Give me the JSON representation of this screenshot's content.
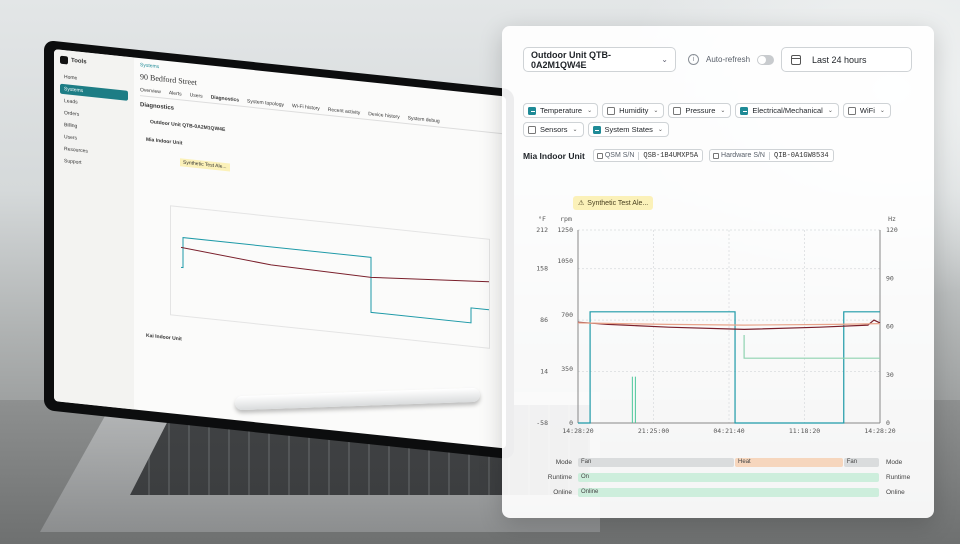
{
  "laptop": {
    "brand": "Tools",
    "nav": [
      "Home",
      "Systems",
      "Leads",
      "Orders",
      "Billing",
      "Users",
      "Resources",
      "Support"
    ],
    "breadcrumb": "Systems",
    "address": "90 Bedford Street",
    "tabs": [
      "Overview",
      "Alerts",
      "Users",
      "Diagnostics",
      "System topology",
      "Wi-Fi history",
      "Recent activity",
      "Device history",
      "System debug"
    ],
    "section": "Diagnostics",
    "unit": "Outdoor Unit QTB-0A2M1QW4E",
    "indoor_a": "Mia Indoor Unit",
    "indoor_b": "Kai Indoor Unit",
    "alert": "Synthetic Test Ale..."
  },
  "panel": {
    "unit_select": "Outdoor Unit QTB-0A2M1QW4E",
    "auto_refresh": "Auto-refresh",
    "time_range": "Last 24 hours",
    "filters": [
      {
        "label": "Temperature",
        "checked": true
      },
      {
        "label": "Humidity",
        "checked": false
      },
      {
        "label": "Pressure",
        "checked": false
      },
      {
        "label": "Electrical/Mechanical",
        "checked": true
      },
      {
        "label": "WiFi",
        "checked": false
      },
      {
        "label": "Sensors",
        "checked": false
      },
      {
        "label": "System States",
        "checked": true
      }
    ],
    "indoor_name": "Mia Indoor Unit",
    "qsm_label": "QSM S/N",
    "qsm_value": "QSB-1B4UMXP5A",
    "hw_label": "Hardware S/N",
    "hw_value": "QIB-0A1GW8534",
    "alert": "Synthetic Test Ale..."
  },
  "chart_data": {
    "type": "line",
    "axis_units": {
      "left_outer": "°F",
      "left_inner": "rpm",
      "right": "Hz"
    },
    "y_left_temp": {
      "ticks": [
        -58,
        14,
        86,
        158,
        212
      ],
      "range": [
        -58,
        212
      ]
    },
    "y_left_rpm": {
      "ticks": [
        0,
        350,
        700,
        1050,
        1250
      ],
      "range": [
        0,
        1250
      ]
    },
    "y_right_hz": {
      "ticks": [
        0,
        30,
        60,
        90,
        120
      ],
      "range": [
        0,
        120
      ]
    },
    "x_ticks": [
      "14:28:20",
      "21:25:00",
      "04:21:40",
      "11:18:20",
      "14:28:20"
    ],
    "series": [
      {
        "color": "#1e9aa8",
        "x": [
          0,
          0.04,
          0.04,
          0.52,
          0.52,
          0.88,
          0.88,
          1.0
        ],
        "y_rpm": [
          0,
          0,
          720,
          720,
          0,
          0,
          720,
          720
        ]
      },
      {
        "color": "#7a1f2b",
        "x": [
          0,
          0.1,
          0.3,
          0.55,
          0.8,
          0.96,
          0.98,
          1.0
        ],
        "y_temp": [
          83,
          80,
          76,
          73,
          76,
          79,
          86,
          82
        ]
      },
      {
        "color": "#e8a48a",
        "x": [
          0,
          0.3,
          0.55,
          0.85,
          1.0
        ],
        "y_temp": [
          82,
          80,
          79,
          80,
          81
        ]
      },
      {
        "color": "#8fd3b0",
        "x": [
          0.55,
          0.55,
          1.0
        ],
        "y_rpm": [
          570,
          420,
          420
        ]
      }
    ],
    "states": {
      "Mode": [
        {
          "label": "Fan",
          "from": 0.0,
          "to": 0.52,
          "color": "#dadcdd"
        },
        {
          "label": "Heat",
          "from": 0.52,
          "to": 0.88,
          "color": "#f6d6bd"
        },
        {
          "label": "Fan",
          "from": 0.88,
          "to": 1.0,
          "color": "#dadcdd"
        }
      ],
      "Runtime": [
        {
          "label": "On",
          "from": 0.0,
          "to": 1.0,
          "color": "#cdeedc"
        }
      ],
      "Online": [
        {
          "label": "Online",
          "from": 0.0,
          "to": 1.0,
          "color": "#cdeedc"
        }
      ]
    }
  }
}
